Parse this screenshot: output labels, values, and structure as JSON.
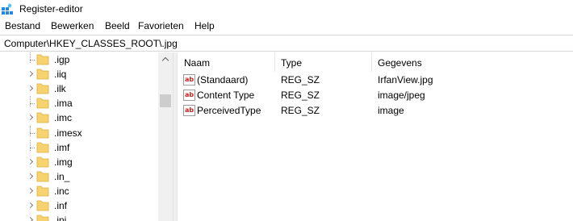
{
  "window": {
    "title": "Register-editor"
  },
  "menu": [
    "Bestand",
    "Bewerken",
    "Beeld",
    "Favorieten",
    "Help"
  ],
  "address": "Computer\\HKEY_CLASSES_ROOT\\.jpg",
  "tree": {
    "items": [
      {
        "label": ".igp",
        "expander": "dots"
      },
      {
        "label": ".iiq",
        "expander": "arrow"
      },
      {
        "label": ".ilk",
        "expander": "arrow"
      },
      {
        "label": ".ima",
        "expander": "dots"
      },
      {
        "label": ".imc",
        "expander": "arrow"
      },
      {
        "label": ".imesx",
        "expander": "dots"
      },
      {
        "label": ".imf",
        "expander": "dots"
      },
      {
        "label": ".img",
        "expander": "arrow"
      },
      {
        "label": ".in_",
        "expander": "arrow"
      },
      {
        "label": ".inc",
        "expander": "arrow"
      },
      {
        "label": ".inf",
        "expander": "arrow"
      },
      {
        "label": ".ini",
        "expander": "arrow"
      }
    ]
  },
  "list": {
    "columns": {
      "name": "Naam",
      "type": "Type",
      "data": "Gegevens"
    },
    "rows": [
      {
        "icon": "ab",
        "name": "(Standaard)",
        "type": "REG_SZ",
        "data": "IrfanView.jpg"
      },
      {
        "icon": "ab",
        "name": "Content Type",
        "type": "REG_SZ",
        "data": "image/jpeg"
      },
      {
        "icon": "ab",
        "name": "PerceivedType",
        "type": "REG_SZ",
        "data": "image"
      }
    ]
  },
  "colors": {
    "folder": "#f6d36f",
    "folder_edge": "#dcae3c",
    "accent": "#0078d7",
    "string_icon": "#d12121"
  }
}
